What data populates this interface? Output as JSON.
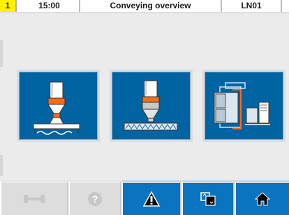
{
  "header": {
    "station_number": "1",
    "time": "15:00",
    "title": "Conveying overview",
    "line_id": "LN01"
  },
  "tiles": [
    {
      "label": "feeding-station-tile"
    },
    {
      "label": "screw-conveyor-tile"
    },
    {
      "label": "machine-screens-tile"
    }
  ],
  "toolbar": {
    "buttons": [
      {
        "name": "wrench",
        "enabled": false
      },
      {
        "name": "help",
        "enabled": false
      },
      {
        "name": "alarm",
        "enabled": true
      },
      {
        "name": "switch-screen",
        "enabled": true
      },
      {
        "name": "home",
        "enabled": true
      }
    ]
  },
  "colors": {
    "tile_blue": "#0064a3",
    "header_yellow": "#fff200",
    "orange": "#ff6a1a",
    "toolbar_blue": "#0b74c0"
  }
}
